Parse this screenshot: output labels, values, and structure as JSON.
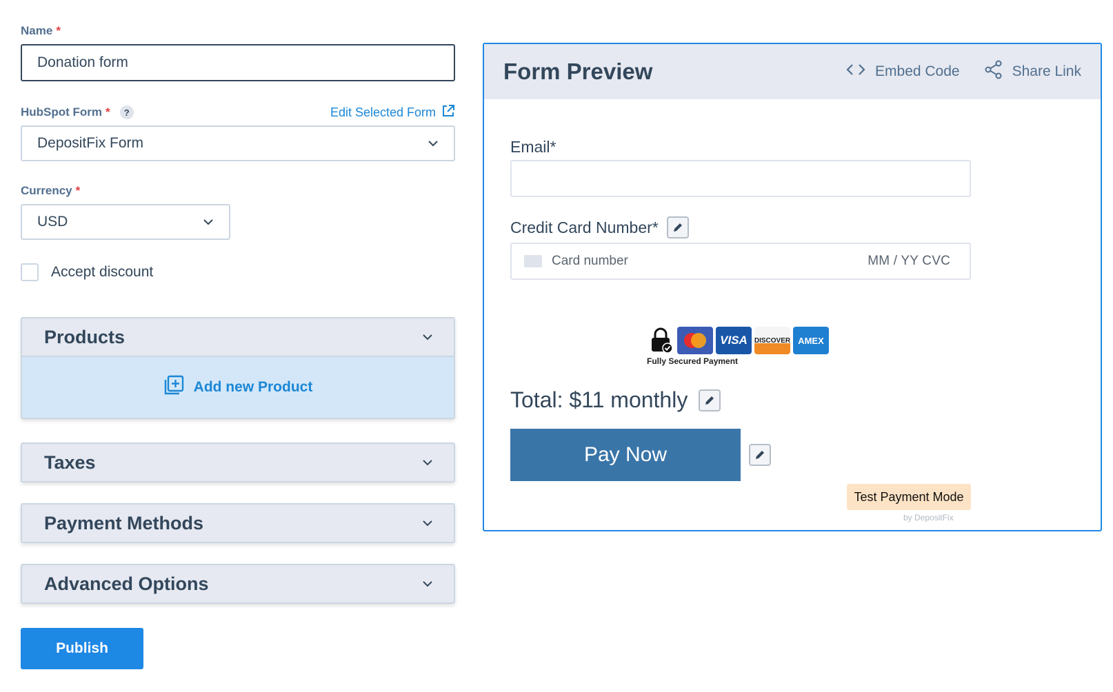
{
  "form": {
    "name_label": "Name",
    "name_required": "*",
    "name_value": "Donation form",
    "hubspot_label": "HubSpot Form",
    "hubspot_required": "*",
    "hubspot_help": "?",
    "edit_selected_form": "Edit Selected Form",
    "hubspot_value": "DepositFix Form",
    "currency_label": "Currency",
    "currency_required": "*",
    "currency_value": "USD",
    "accept_discount": "Accept discount",
    "accept_discount_checked": false
  },
  "sections": {
    "products": "Products",
    "add_product": "Add new Product",
    "taxes": "Taxes",
    "payment_methods": "Payment Methods",
    "advanced_options": "Advanced Options"
  },
  "publish_label": "Publish",
  "preview": {
    "title": "Form Preview",
    "embed_code": "Embed Code",
    "share_link": "Share Link",
    "email_label": "Email*",
    "cc_label": "Credit Card Number*",
    "card_placeholder": "Card number",
    "card_exp_cvc": "MM / YY  CVC",
    "secured_payment": "Fully Secured Payment",
    "card_brands": [
      "VISA",
      "DISCOVER",
      "AMEX"
    ],
    "total": "Total: $11 monthly",
    "pay_now": "Pay Now",
    "test_mode": "Test Payment Mode",
    "powered_by": "by DepositFix"
  },
  "colors": {
    "accent": "#1e88e5",
    "pay_button": "#3a75a8",
    "test_badge": "#fde3c5",
    "required": "#e33e3e"
  }
}
